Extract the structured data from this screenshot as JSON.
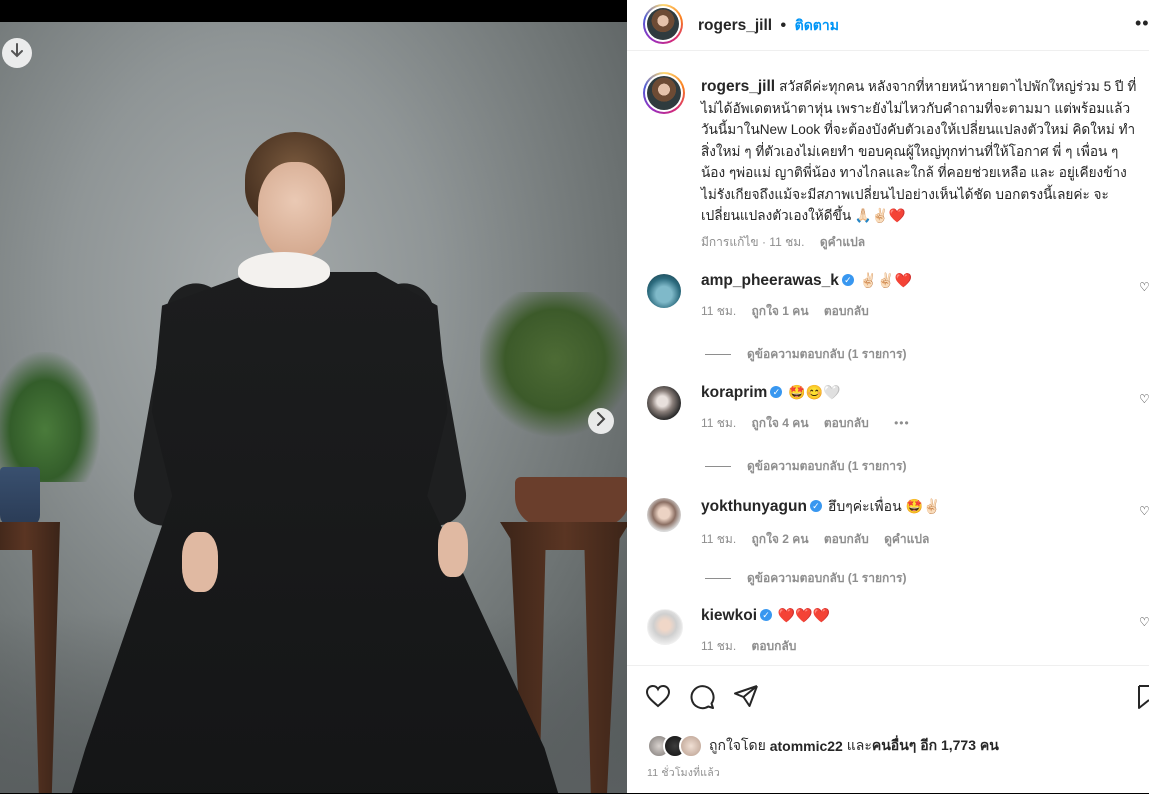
{
  "post": {
    "username": "rogers_jill",
    "follow_label": "ติดตาม",
    "caption": "สวัสดีค่ะทุกคน หลังจากที่หายหน้าหายตาไปพักใหญ่ร่วม 5 ปี ที่ไม่ได้อัพเดตหน้าตาหุ่น เพราะยังไม่ไหวกับคำถามที่จะตามมา แต่พร้อมแล้ว วันนี้มาในNew Look ที่จะต้องบังคับตัวเองให้เปลี่ยนแปลงตัวใหม่ คิดใหม่ ทำสิ่งใหม่ ๆ ที่ตัวเองไม่เคยทำ ขอบคุณผู้ใหญ่ทุกท่านที่ให้โอกาศ พี่ ๆ เพื่อน ๆ น้อง ๆพ่อแม่ ญาติพี่น้อง ทางไกลและใกล้ ที่คอยช่วยเหลือ และ อยู่เคียงข้าง ไม่รังเกียจถึงแม้จะมีสภาพเปลี่ยนไปอย่างเห็นได้ชัด บอกตรงนี้เลยค่ะ จะเปลี่ยนแปลงตัวเองให้ดีขึ้น 🙏🏻✌🏻❤️",
    "caption_edited": "มีการแก้ไข",
    "caption_time": "11 ชม.",
    "caption_translate": "ดูคำแปล"
  },
  "comments": [
    {
      "username": "amp_pheerawas_k",
      "verified": true,
      "text": "✌🏻✌🏻❤️",
      "time": "11 ชม.",
      "likes": "ถูกใจ 1 คน",
      "reply": "ตอบกลับ",
      "translate": "",
      "more": "",
      "replies": "ดูข้อความตอบกลับ (1 รายการ)"
    },
    {
      "username": "koraprim",
      "verified": true,
      "text": "🤩😊🤍",
      "time": "11 ชม.",
      "likes": "ถูกใจ 4 คน",
      "reply": "ตอบกลับ",
      "translate": "",
      "more": "•••",
      "replies": "ดูข้อความตอบกลับ (1 รายการ)"
    },
    {
      "username": "yokthunyagun",
      "verified": true,
      "text": "ฮึบๆค่ะเพื่อน 🤩✌🏻",
      "time": "11 ชม.",
      "likes": "ถูกใจ 2 คน",
      "reply": "ตอบกลับ",
      "translate": "ดูคำแปล",
      "more": "",
      "replies": "ดูข้อความตอบกลับ (1 รายการ)"
    },
    {
      "username": "kiewkoi",
      "verified": true,
      "text": "❤️❤️❤️",
      "time": "11 ชม.",
      "likes": "",
      "reply": "ตอบกลับ",
      "translate": "",
      "more": "",
      "replies": ""
    }
  ],
  "footer": {
    "liked_by_prefix": "ถูกใจโดย",
    "liked_by_user": "atommic22",
    "liked_by_and": "และ",
    "liked_by_others": "คนอื่นๆ อีก 1,773 คน",
    "timestamp": "11 ชั่วโมงที่แล้ว"
  },
  "colors": {
    "link": "#0095f6",
    "muted": "#8e8e8e",
    "text": "#262626",
    "verified": "#3897f0"
  }
}
